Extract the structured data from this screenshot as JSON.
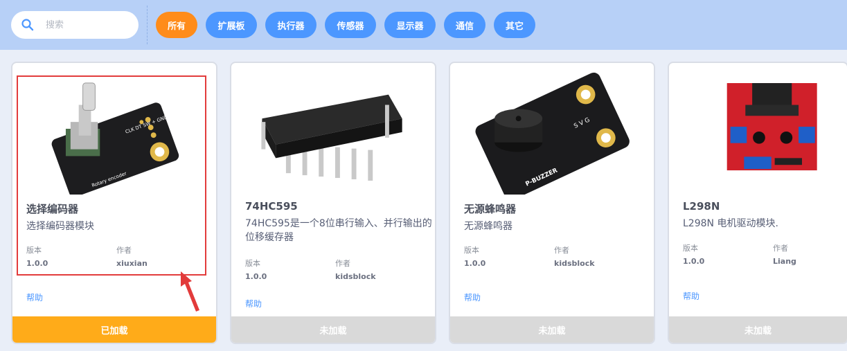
{
  "search": {
    "placeholder": "搜索"
  },
  "filters": [
    "所有",
    "扩展板",
    "执行器",
    "传感器",
    "显示器",
    "通信",
    "其它"
  ],
  "labels": {
    "version": "版本",
    "author": "作者",
    "help": "帮助"
  },
  "cards": [
    {
      "name": "选择编码器",
      "description": "选择编码器模块",
      "version": "1.0.0",
      "author": "xiuxian",
      "status": "已加载"
    },
    {
      "name": "74HC595",
      "description": "74HC595是一个8位串行输入、并行输出的位移缓存器",
      "version": "1.0.0",
      "author": "kidsblock",
      "status": "未加载"
    },
    {
      "name": "无源蜂鸣器",
      "description": "无源蜂鸣器",
      "version": "1.0.0",
      "author": "kidsblock",
      "status": "未加载"
    },
    {
      "name": "L298N",
      "description": "L298N 电机驱动模块.",
      "version": "1.0.0",
      "author": "Liang",
      "status": "未加载"
    }
  ],
  "images": {
    "encoder_pins": "CLK DT SW + GND",
    "encoder_text": "Rotary encoder",
    "buzzer_text": "P-BUZZER",
    "buzzer_pins": "S V G"
  },
  "colors": {
    "active_tag": "#ff8c1a",
    "tag": "#4c97ff",
    "loaded": "#ffab19",
    "not_loaded": "#d9d9d9",
    "highlight": "#e23b3b"
  }
}
